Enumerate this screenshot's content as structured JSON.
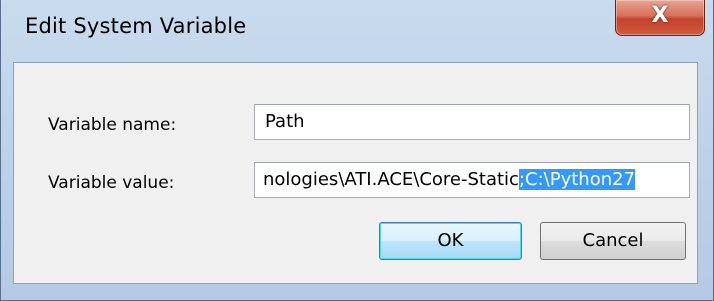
{
  "dialog": {
    "title": "Edit System Variable",
    "close_label": "X"
  },
  "form": {
    "name_label": "Variable name:",
    "name_value": "Path",
    "value_label": "Variable value:",
    "value_text_visible": "nologies\\ATI.ACE\\Core-Static",
    "value_text_selected": ";C:\\Python27"
  },
  "buttons": {
    "ok_label": "OK",
    "cancel_label": "Cancel"
  },
  "colors": {
    "selection_bg": "#3399ff",
    "close_button": "#c2432b",
    "frame": "#bfd3ea"
  }
}
